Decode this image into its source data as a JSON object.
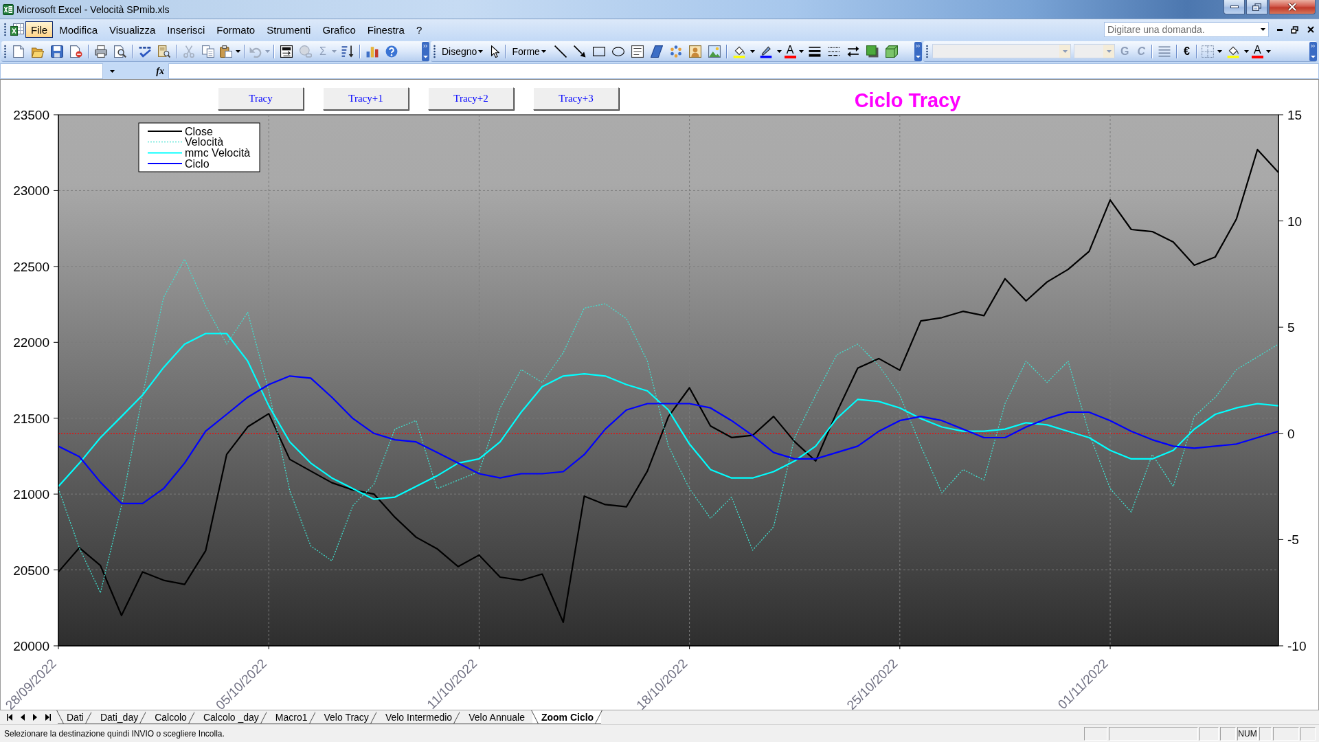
{
  "window": {
    "title": "Microsoft Excel - Velocità SPmib.xls"
  },
  "menu": [
    {
      "label": "File",
      "selected": true
    },
    {
      "label": "Modifica",
      "selected": false
    },
    {
      "label": "Visualizza",
      "selected": false
    },
    {
      "label": "Inserisci",
      "selected": false
    },
    {
      "label": "Formato",
      "selected": false
    },
    {
      "label": "Strumenti",
      "selected": false
    },
    {
      "label": "Grafico",
      "selected": false
    },
    {
      "label": "Finestra",
      "selected": false
    },
    {
      "label": "?",
      "selected": false
    }
  ],
  "help_box": {
    "placeholder": "Digitare una domanda."
  },
  "toolbar": {
    "autosum": {
      "label": "Σ",
      "disabled": true
    },
    "drawing_menu": "Disegno",
    "shapes_menu": "Forme",
    "drawing_font_color": "A",
    "bold": {
      "label": "G",
      "disabled": true
    },
    "italic": {
      "label": "C",
      "disabled": true
    },
    "currency_style": "€",
    "font_color": "A"
  },
  "formula_bar": {
    "function_button": "fx"
  },
  "chart": {
    "buttons": [
      "Tracy",
      "Tracy+1",
      "Tracy+2",
      "Tracy+3"
    ],
    "chart_data": {
      "type": "line",
      "title": "Ciclo Tracy",
      "grid": true,
      "legend": "upper left",
      "categories": [
        "28/09/2022",
        null,
        null,
        null,
        null,
        null,
        null,
        null,
        null,
        null,
        "05/10/2022",
        null,
        null,
        null,
        null,
        null,
        null,
        null,
        null,
        null,
        "11/10/2022",
        null,
        null,
        null,
        null,
        null,
        null,
        null,
        null,
        null,
        "18/10/2022",
        null,
        null,
        null,
        null,
        null,
        null,
        null,
        null,
        null,
        "25/10/2022",
        null,
        null,
        null,
        null,
        null,
        null,
        null,
        null,
        null,
        "01/11/2022",
        null,
        null,
        null,
        null,
        null,
        null,
        null,
        null
      ],
      "ylim": [
        20000,
        23500
      ],
      "yticks": [
        20000,
        20500,
        21000,
        21500,
        22000,
        22500,
        23000,
        23500
      ],
      "y2lim": [
        -10,
        15
      ],
      "y2ticks": [
        -10,
        -5,
        0,
        5,
        10,
        15
      ],
      "series": [
        {
          "name": "Close",
          "color": "#000000",
          "line_style": "solid",
          "values": [
            20487,
            20646,
            20529,
            20200,
            20487,
            20432,
            20405,
            20626,
            21262,
            21443,
            21530,
            21229,
            21152,
            21075,
            21027,
            21000,
            20847,
            20716,
            20640,
            20522,
            20598,
            20453,
            20432,
            20473,
            20155,
            20986,
            20931,
            20916,
            21152,
            21511,
            21700,
            21449,
            21373,
            21387,
            21512,
            21345,
            21218,
            21539,
            21830,
            21893,
            21816,
            22141,
            22163,
            22204,
            22176,
            22419,
            22273,
            22398,
            22481,
            22600,
            22938,
            22744,
            22730,
            22661,
            22509,
            22563,
            22813,
            23270,
            23120
          ]
        },
        {
          "name": "Velocità",
          "color": "#40e0d0",
          "axis": "y2",
          "line_style": "dotted",
          "values": [
            -2.6,
            -5.4,
            -7.5,
            -3.4,
            1.8,
            6.4,
            8.2,
            6.0,
            4.2,
            5.7,
            2.0,
            -2.7,
            -5.3,
            -6.0,
            -3.4,
            -2.4,
            0.2,
            0.6,
            -2.6,
            -2.2,
            -1.8,
            1.2,
            3.0,
            2.4,
            3.8,
            5.9,
            6.1,
            5.4,
            3.4,
            -0.6,
            -2.6,
            -4.0,
            -3.0,
            -5.5,
            -4.4,
            -0.2,
            1.8,
            3.7,
            4.2,
            3.2,
            1.8,
            -0.6,
            -2.8,
            -1.7,
            -2.2,
            1.4,
            3.4,
            2.4,
            3.4,
            0.0,
            -2.6,
            -3.7,
            -1.0,
            -2.5,
            0.8,
            1.7,
            3.0,
            3.6,
            4.2
          ]
        },
        {
          "name": "mmc Velocità",
          "color": "#00ffff",
          "axis": "y2",
          "line_style": "solid",
          "values": [
            -2.5,
            -1.4,
            -0.2,
            0.8,
            1.8,
            3.1,
            4.2,
            4.7,
            4.7,
            3.4,
            1.3,
            -0.4,
            -1.4,
            -2.1,
            -2.6,
            -3.1,
            -3.0,
            -2.5,
            -2.0,
            -1.4,
            -1.2,
            -0.4,
            1.0,
            2.2,
            2.7,
            2.8,
            2.7,
            2.3,
            2.0,
            1.1,
            -0.5,
            -1.7,
            -2.1,
            -2.1,
            -1.8,
            -1.3,
            -0.6,
            0.7,
            1.6,
            1.5,
            1.2,
            0.7,
            0.3,
            0.1,
            0.1,
            0.2,
            0.5,
            0.4,
            0.1,
            -0.2,
            -0.8,
            -1.2,
            -1.2,
            -0.8,
            0.2,
            0.9,
            1.2,
            1.4,
            1.3
          ]
        },
        {
          "name": "Ciclo",
          "color": "#0000ff",
          "axis": "y2",
          "line_style": "solid",
          "values": [
            -0.6,
            -1.1,
            -2.3,
            -3.3,
            -3.3,
            -2.6,
            -1.4,
            0.1,
            0.9,
            1.7,
            2.3,
            2.7,
            2.6,
            1.7,
            0.7,
            0.0,
            -0.3,
            -0.4,
            -0.9,
            -1.4,
            -1.9,
            -2.1,
            -1.9,
            -1.9,
            -1.8,
            -1.0,
            0.2,
            1.1,
            1.4,
            1.4,
            1.4,
            1.2,
            0.6,
            -0.1,
            -0.9,
            -1.2,
            -1.2,
            -0.9,
            -0.6,
            0.1,
            0.6,
            0.8,
            0.6,
            0.2,
            -0.2,
            -0.2,
            0.3,
            0.7,
            1.0,
            1.0,
            0.6,
            0.1,
            -0.3,
            -0.6,
            -0.7,
            -0.6,
            -0.5,
            -0.2,
            0.1
          ]
        }
      ],
      "ref_lines": [
        {
          "value": 0,
          "axis": "y2",
          "color": "#ff0000"
        }
      ]
    }
  },
  "sheet_tabs": [
    {
      "label": "Dati",
      "selected": false
    },
    {
      "label": "Dati_day",
      "selected": false
    },
    {
      "label": "Calcolo",
      "selected": false
    },
    {
      "label": "Calcolo _day",
      "selected": false
    },
    {
      "label": "Macro1",
      "selected": false
    },
    {
      "label": "Velo Tracy",
      "selected": false
    },
    {
      "label": "Velo Intermedio",
      "selected": false
    },
    {
      "label": "Velo Annuale",
      "selected": false
    },
    {
      "label": "Zoom Ciclo",
      "selected": true
    }
  ],
  "status_bar": {
    "message": "Selezionare la destinazione quindi INVIO o scegliere Incolla.",
    "num_lock": "NUM"
  }
}
